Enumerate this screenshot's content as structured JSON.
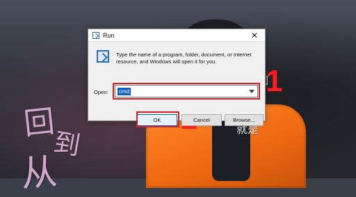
{
  "background": {
    "calligraphy": [
      "回",
      "到",
      "从",
      "就是",
      "回"
    ],
    "annotations": [
      "1",
      "2"
    ],
    "accent_color": "#ff1e1e"
  },
  "dialog": {
    "title": "Run",
    "close_icon": "close-icon",
    "description": "Type the name of a program, folder, document, or Internet resource, and Windows will open it for you.",
    "open_label": "Open:",
    "open_value": "cmd",
    "buttons": {
      "ok": "OK",
      "cancel": "Cancel",
      "browse": "Browse..."
    }
  }
}
